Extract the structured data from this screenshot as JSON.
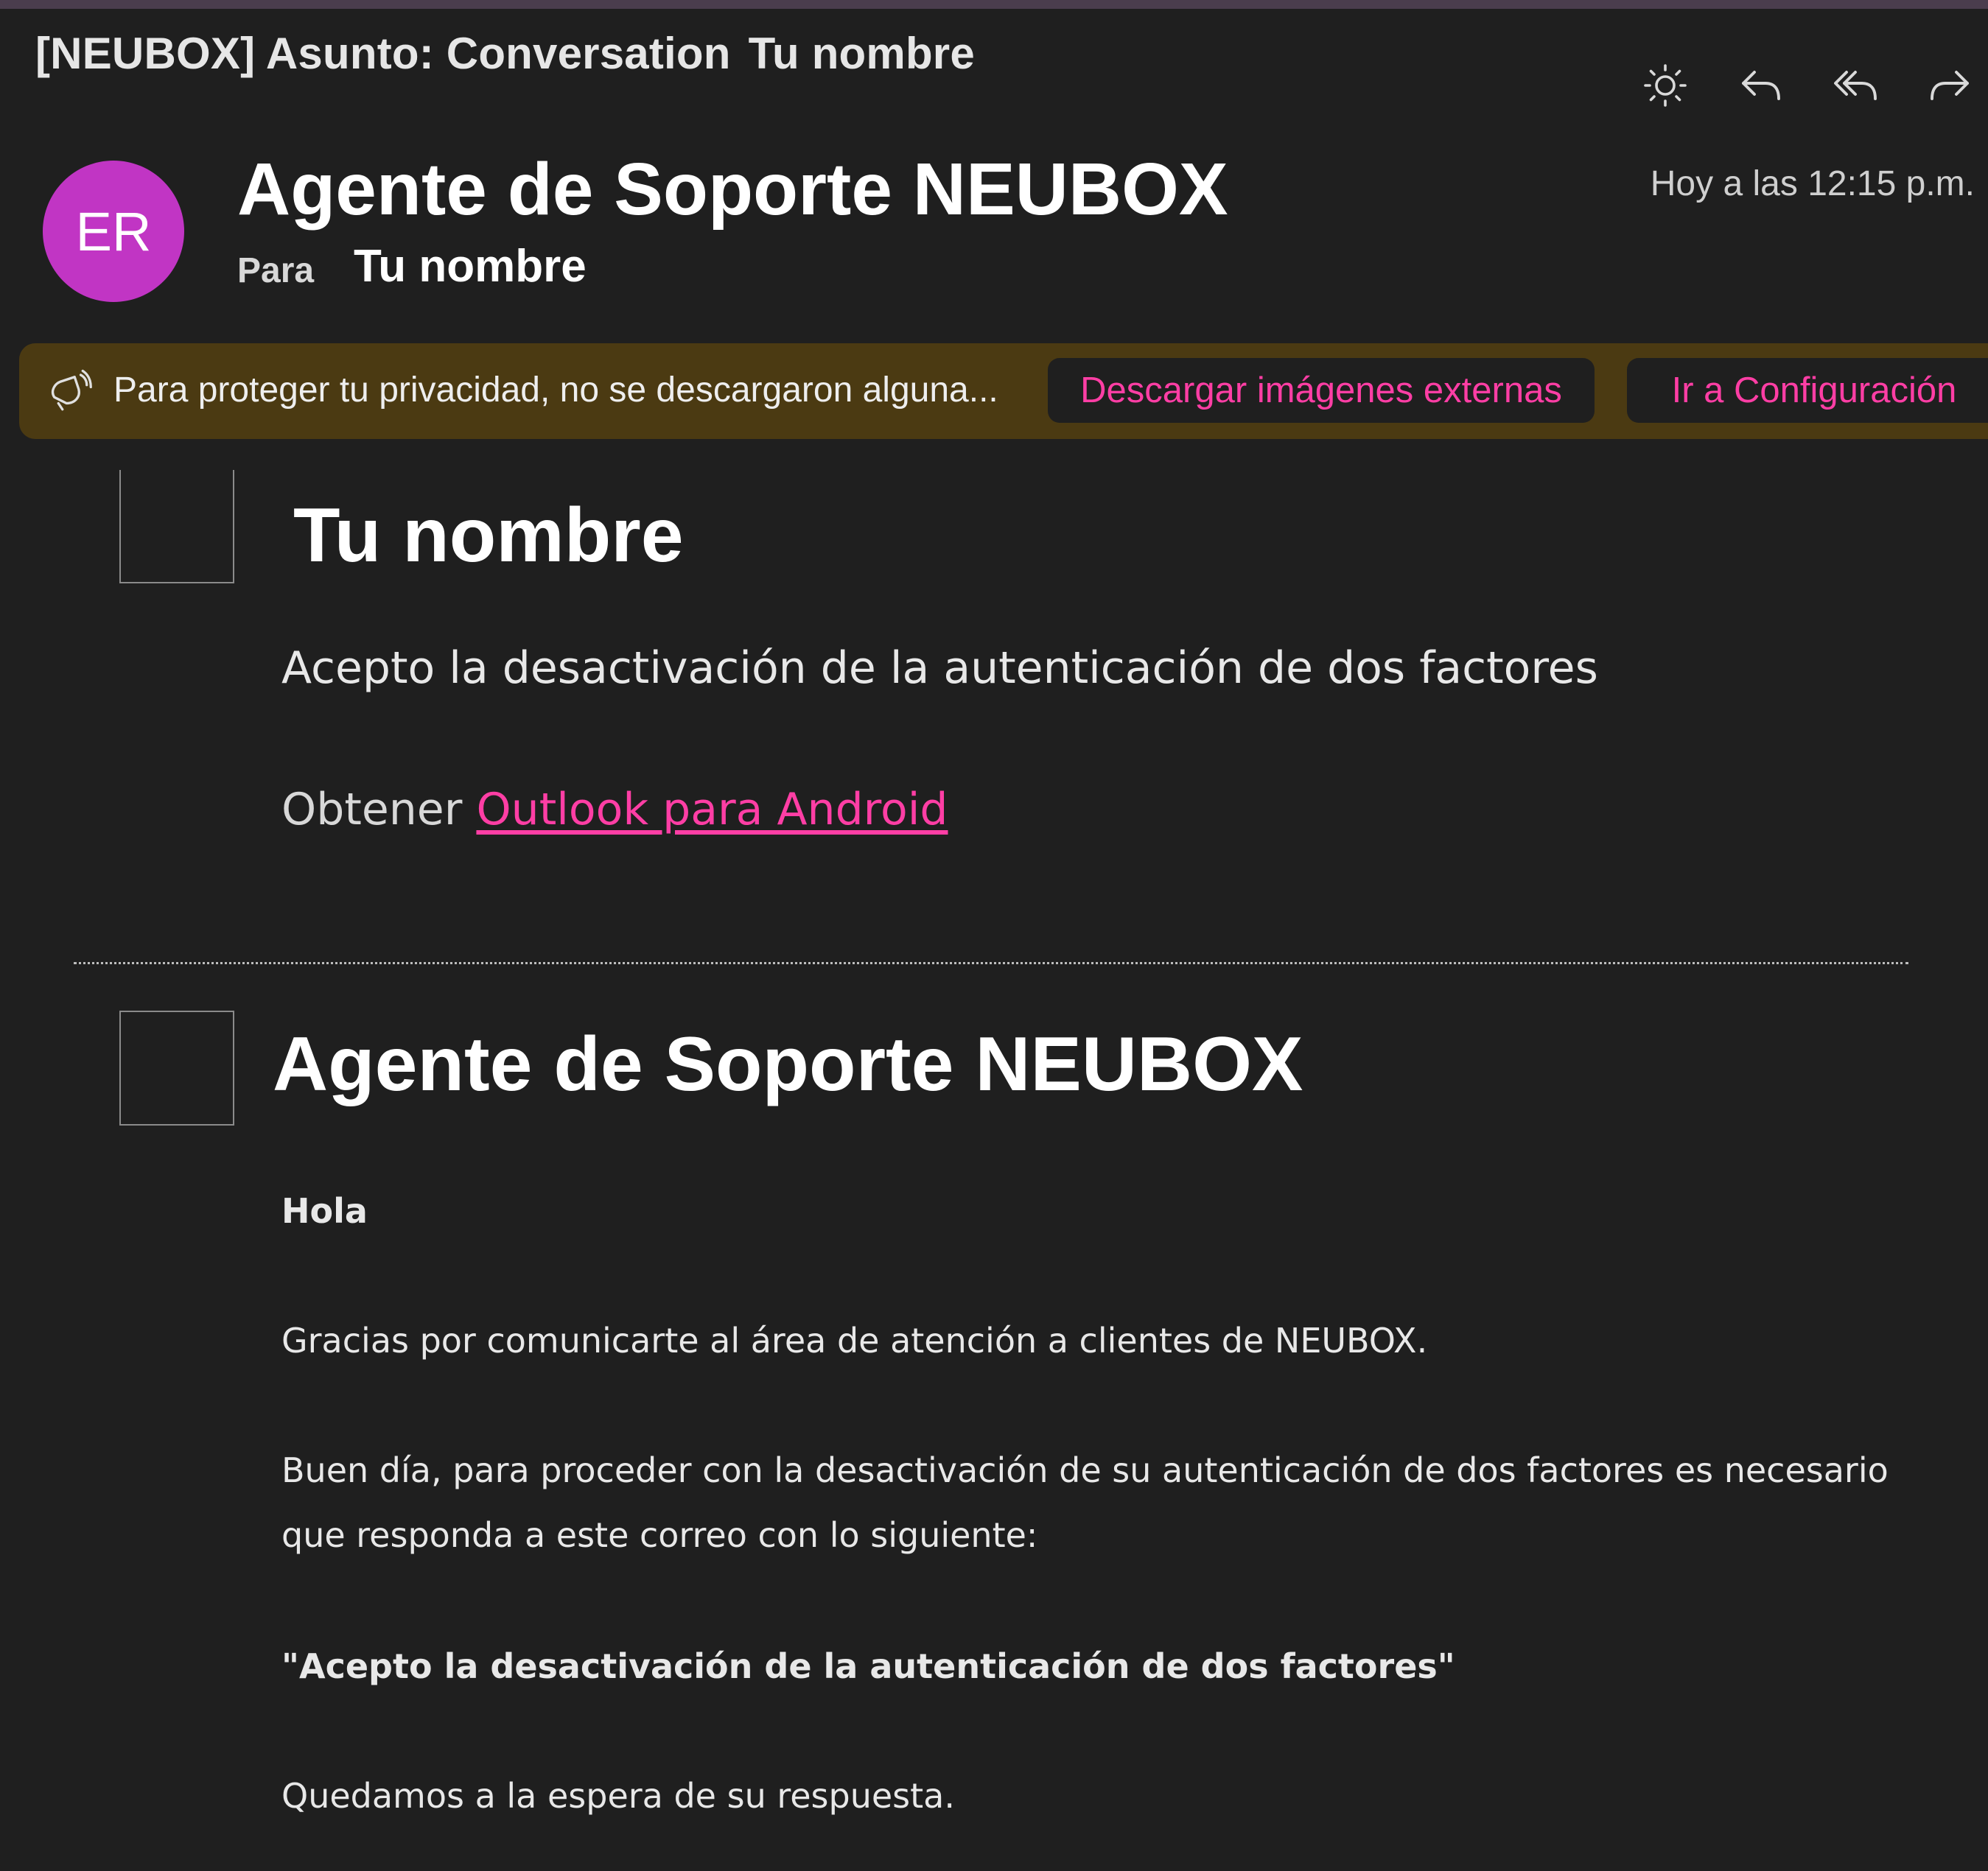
{
  "header": {
    "subject": "[NEUBOX] Asunto: Conversation",
    "subject_name": "Tu nombre",
    "icons": [
      "sun-icon",
      "reply-icon",
      "reply-all-icon",
      "forward-icon"
    ]
  },
  "message": {
    "avatar_initials": "ER",
    "avatar_color": "#c135c4",
    "sender": "Agente de Soporte NEUBOX",
    "to_label": "Para",
    "to_name": "Tu nombre",
    "date": "Hoy a las 12:15 p.m."
  },
  "privacy_banner": {
    "text": "Para proteger tu privacidad, no se descargaron alguna...",
    "download_button": "Descargar imágenes externas",
    "settings_button": "Ir a Configuración",
    "accent_color": "#ff3ea5",
    "background_color": "#4b3a12"
  },
  "reply": {
    "name": "Tu nombre",
    "text": "Acepto la desactivación de la autenticación de dos factores",
    "footer_prefix": "Obtener",
    "footer_link": "Outlook para Android"
  },
  "quoted": {
    "name": "Agente de Soporte NEUBOX",
    "greeting": "Hola",
    "thanks": "Gracias por comunicarte al área de atención a clientes de NEUBOX.",
    "instructions_line1": "Buen día, para proceder con la desactivación de su autenticación de dos factores es necesario",
    "instructions_line2": "que responda a este correo con lo siguiente:",
    "quote": "\"Acepto la desactivación de la autenticación de dos factores\"",
    "closing": "Quedamos a la espera de su respuesta."
  }
}
